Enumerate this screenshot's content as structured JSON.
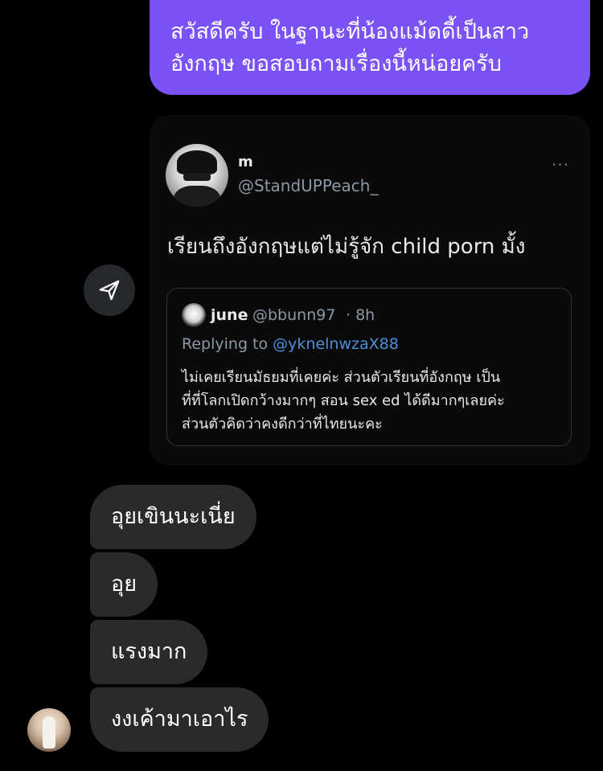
{
  "sent_message": {
    "text": "สวัสดีครับ ในฐานะที่น้องแม้ดดี้เป็นสาว\nอังกฤษ ขอสอบถามเรื่องนี้หน่อยครับ"
  },
  "shared_tweet": {
    "author_name": "m",
    "author_handle": "@StandUPPeach_",
    "more_label": "···",
    "text": "เรียนถึงอังกฤษแต่ไม่รู้จัก child porn มั้ง",
    "quoted": {
      "name": "june",
      "handle": "@bbunn97",
      "time": "· 8h",
      "replying_prefix": "Replying to ",
      "replying_to": "@yknelnwzaX88",
      "text": "ไม่เคยเรียนมัธยมที่เคยค่ะ ส่วนตัวเรียนที่อังกฤษ เป็น\nที่ที่โลกเปิดกว้างมากๆ สอน sex ed ได้ดีมากๆเลยค่ะ\nส่วนตัวคิดว่าคงดีกว่าที่ไทยนะคะ"
    }
  },
  "received_messages": [
    "อุยเขินนะเนี่ย",
    "อุย",
    "แรงมาก",
    "งงเค้ามาเอาไร"
  ],
  "colors": {
    "background": "#000000",
    "sent_bubble": "#7b52f5",
    "received_bubble": "#2a2a2a",
    "link": "#4d8fd9",
    "muted_text": "#8b98a5"
  },
  "icons": {
    "share": "paper-plane-icon",
    "more": "ellipsis-icon"
  }
}
